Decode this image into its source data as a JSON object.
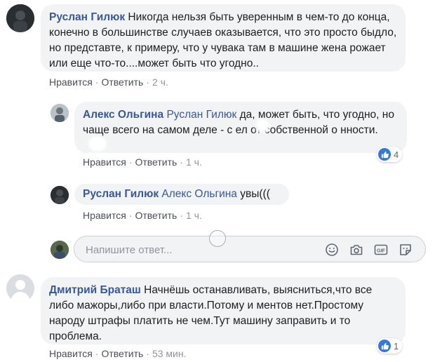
{
  "comments": [
    {
      "author": "Руслан Гилюк",
      "text": "Никогда нельзя быть уверенным в чем-то до конца, конечно в большинстве случаев оказывается, что это просто быдло, но представте, к примеру, что у чувака там в машине жена рожает или еще что-то....может быть что угодно..",
      "like": "Нравится",
      "reply": "Ответить",
      "time": "2 ч."
    },
    {
      "author": "Алекс Ольгина",
      "mention": "Руслан Гилюк",
      "text": "да, может быть, что угодно, но чаще всего на самом деле - с ел от собственной о нности.",
      "like": "Нравится",
      "reply": "Ответить",
      "time": "1 ч.",
      "reactions": "4"
    },
    {
      "author": "Руслан Гилюк",
      "mention": "Алекс Ольгина",
      "text": "увы(((",
      "like": "Нравится",
      "reply": "Ответить",
      "time": "1 ч."
    },
    {
      "author": "Дмитрий Браташ",
      "text": "Начнёшь останавливать, выясниться,что все либо мажоры,либо при власти.Потому и ментов нет.Простому народу штрафы платить не чем.Тут машину заправить и то проблема.",
      "like": "Нравится",
      "reply": "Ответить",
      "time": "53 мин.",
      "reactions": "1"
    }
  ],
  "composer": {
    "placeholder": "Напишите ответ...",
    "icons": [
      "emoji-icon",
      "camera-icon",
      "gif-icon",
      "sticker-icon"
    ]
  },
  "colors": {
    "author": "#385898",
    "bubble": "#f2f3f5",
    "like": "#3578e5"
  }
}
